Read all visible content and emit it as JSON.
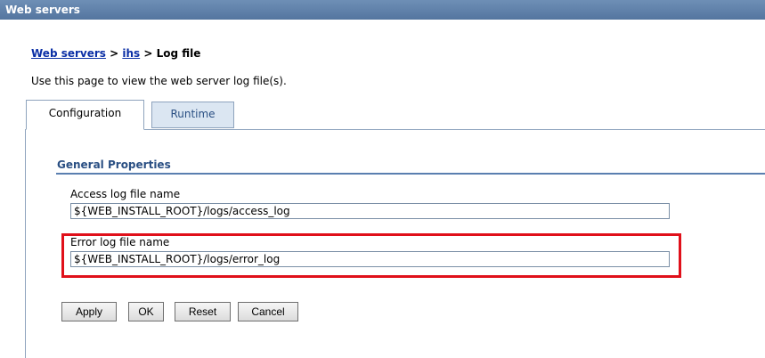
{
  "window": {
    "title": "Web servers"
  },
  "breadcrumb": {
    "link1": "Web servers",
    "sep1": " > ",
    "link2": "ihs",
    "sep2": " > ",
    "current": "Log file"
  },
  "description": "Use this page to view the web server log file(s).",
  "tabs": [
    {
      "label": "Configuration"
    },
    {
      "label": "Runtime"
    }
  ],
  "general": {
    "title": "General Properties",
    "access_label": "Access log file name",
    "access_value": "${WEB_INSTALL_ROOT}/logs/access_log",
    "error_label": "Error log file name",
    "error_value": "${WEB_INSTALL_ROOT}/logs/error_log"
  },
  "buttons": {
    "apply": "Apply",
    "ok": "OK",
    "reset": "Reset",
    "cancel": "Cancel"
  },
  "colors": {
    "highlight": "#e0101a",
    "link": "#0b2fa6",
    "title_bar": "#54759f"
  }
}
